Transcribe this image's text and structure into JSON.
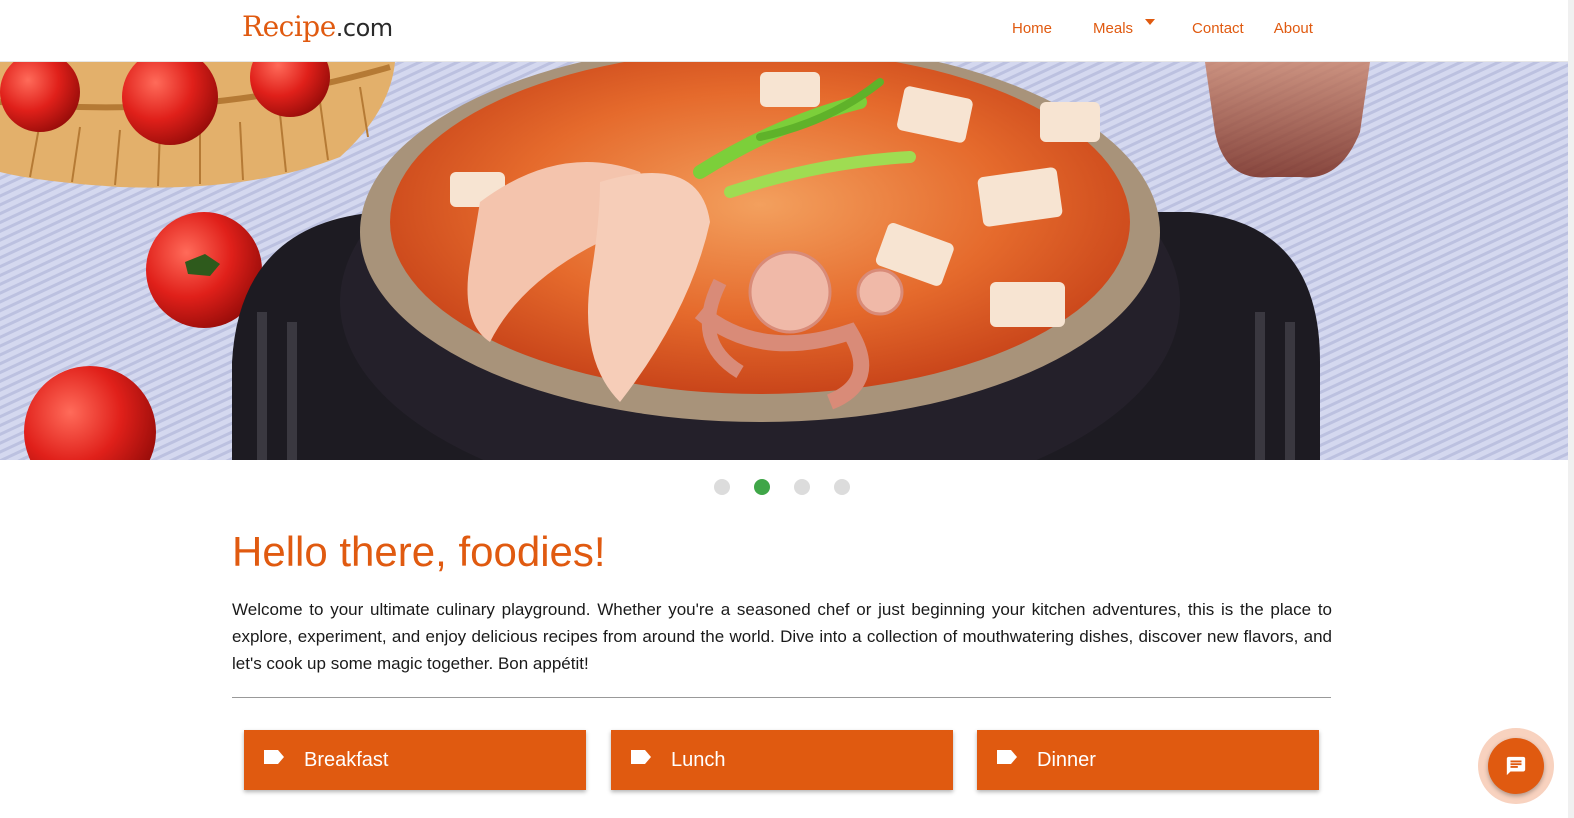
{
  "brand": {
    "name_part1": "Recipe",
    "name_part2": ".com"
  },
  "nav": {
    "items": [
      {
        "label": "Home"
      },
      {
        "label": "Meals"
      },
      {
        "label": "Contact"
      },
      {
        "label": "About"
      }
    ]
  },
  "carousel": {
    "slide_count": 4,
    "active_index": 1,
    "active_color": "#3fa648",
    "inactive_color": "#dcdcdc"
  },
  "main": {
    "title": "Hello there, foodies!",
    "intro": "Welcome to your ultimate culinary playground. Whether you're a seasoned chef or just beginning your kitchen adventures, this is the place to explore, experiment, and enjoy delicious recipes from around the world. Dive into a collection of mouthwatering dishes, discover new flavors, and let's cook up some magic together. Bon appétit!",
    "categories": [
      {
        "label": "Breakfast",
        "icon": "tag-icon"
      },
      {
        "label": "Lunch",
        "icon": "tag-icon"
      },
      {
        "label": "Dinner",
        "icon": "tag-icon"
      }
    ]
  },
  "chat": {
    "icon": "chat-icon"
  },
  "colors": {
    "accent": "#e05a10",
    "text": "#1a1a1a"
  }
}
